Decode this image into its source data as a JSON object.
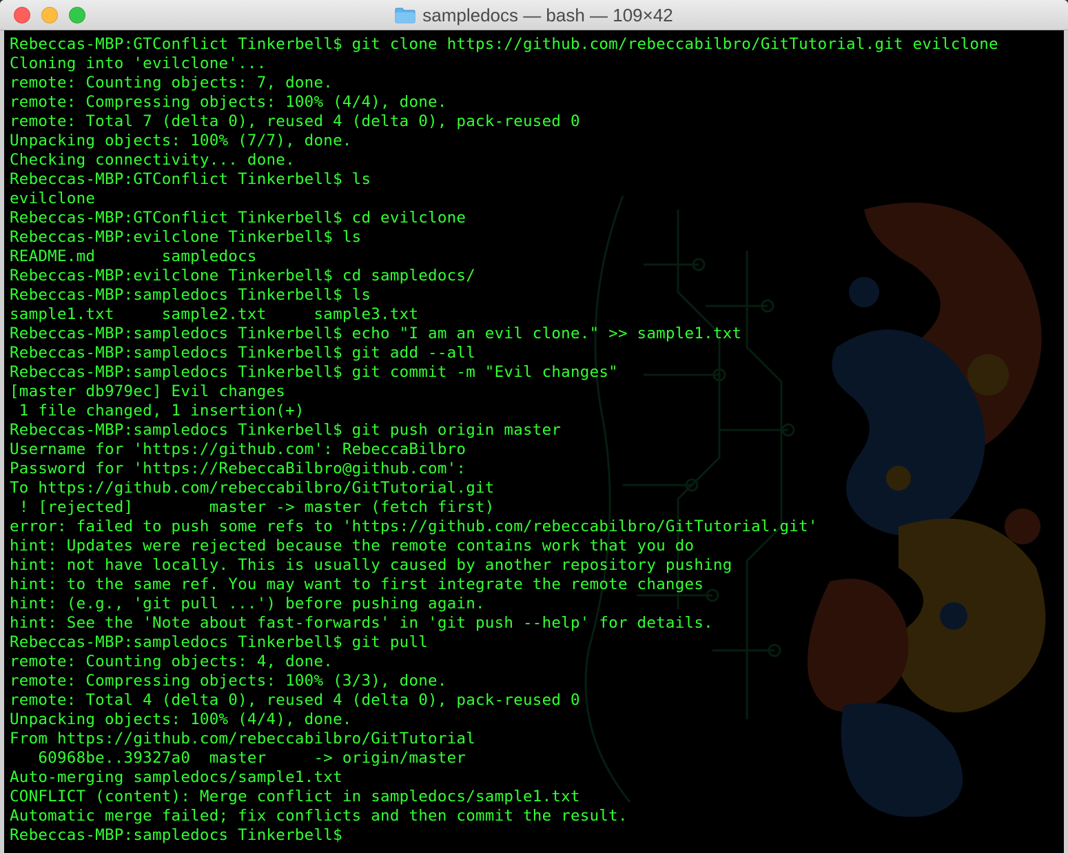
{
  "window": {
    "title": "sampledocs — bash — 109×42"
  },
  "terminal": {
    "lines": [
      "Rebeccas-MBP:GTConflict Tinkerbell$ git clone https://github.com/rebeccabilbro/GitTutorial.git evilclone",
      "Cloning into 'evilclone'...",
      "remote: Counting objects: 7, done.",
      "remote: Compressing objects: 100% (4/4), done.",
      "remote: Total 7 (delta 0), reused 4 (delta 0), pack-reused 0",
      "Unpacking objects: 100% (7/7), done.",
      "Checking connectivity... done.",
      "Rebeccas-MBP:GTConflict Tinkerbell$ ls",
      "evilclone",
      "Rebeccas-MBP:GTConflict Tinkerbell$ cd evilclone",
      "Rebeccas-MBP:evilclone Tinkerbell$ ls",
      "README.md       sampledocs",
      "Rebeccas-MBP:evilclone Tinkerbell$ cd sampledocs/",
      "Rebeccas-MBP:sampledocs Tinkerbell$ ls",
      "sample1.txt     sample2.txt     sample3.txt",
      "Rebeccas-MBP:sampledocs Tinkerbell$ echo \"I am an evil clone.\" >> sample1.txt",
      "Rebeccas-MBP:sampledocs Tinkerbell$ git add --all",
      "Rebeccas-MBP:sampledocs Tinkerbell$ git commit -m \"Evil changes\"",
      "[master db979ec] Evil changes",
      " 1 file changed, 1 insertion(+)",
      "Rebeccas-MBP:sampledocs Tinkerbell$ git push origin master",
      "Username for 'https://github.com': RebeccaBilbro",
      "Password for 'https://RebeccaBilbro@github.com':",
      "To https://github.com/rebeccabilbro/GitTutorial.git",
      " ! [rejected]        master -> master (fetch first)",
      "error: failed to push some refs to 'https://github.com/rebeccabilbro/GitTutorial.git'",
      "hint: Updates were rejected because the remote contains work that you do",
      "hint: not have locally. This is usually caused by another repository pushing",
      "hint: to the same ref. You may want to first integrate the remote changes",
      "hint: (e.g., 'git pull ...') before pushing again.",
      "hint: See the 'Note about fast-forwards' in 'git push --help' for details.",
      "Rebeccas-MBP:sampledocs Tinkerbell$ git pull",
      "remote: Counting objects: 4, done.",
      "remote: Compressing objects: 100% (3/3), done.",
      "remote: Total 4 (delta 0), reused 4 (delta 0), pack-reused 0",
      "Unpacking objects: 100% (4/4), done.",
      "From https://github.com/rebeccabilbro/GitTutorial",
      "   60968be..39327a0  master     -> origin/master",
      "Auto-merging sampledocs/sample1.txt",
      "CONFLICT (content): Merge conflict in sampledocs/sample1.txt",
      "Automatic merge failed; fix conflicts and then commit the result.",
      "Rebeccas-MBP:sampledocs Tinkerbell$ "
    ]
  },
  "colors": {
    "text": "#33ff33",
    "background": "#000000",
    "close": "#fc605c",
    "minimize": "#fdbc40",
    "zoom": "#34c84a"
  },
  "icons": {
    "title": "folder-icon"
  }
}
